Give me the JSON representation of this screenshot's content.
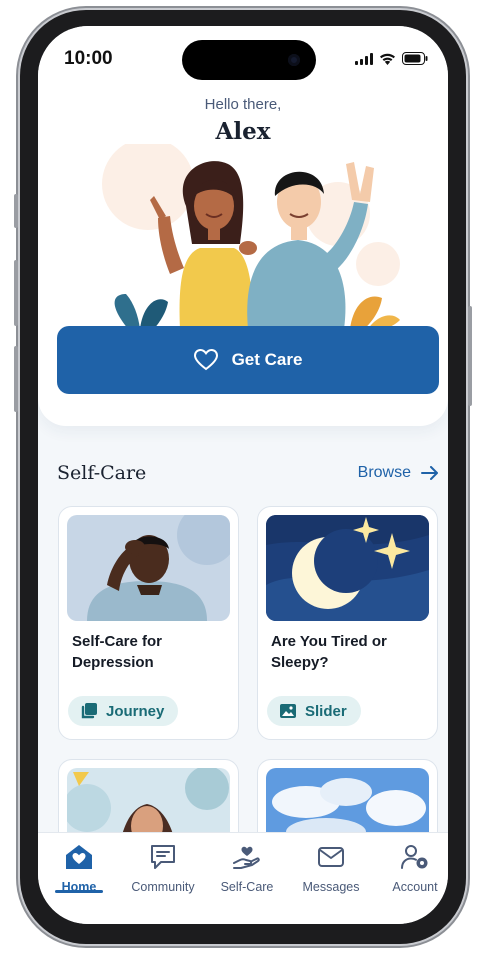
{
  "status_bar": {
    "time": "10:00"
  },
  "greeting": {
    "salutation": "Hello there,",
    "name": "Alex"
  },
  "get_care_button": {
    "label": "Get Care",
    "icon": "heart-outline-icon"
  },
  "self_care": {
    "title": "Self-Care",
    "browse_label": "Browse",
    "cards": [
      {
        "title": "Self-Care for Depression",
        "chip_label": "Journey",
        "chip_icon": "journey-stack-icon",
        "image": "man-holding-head-photo"
      },
      {
        "title": "Are You Tired or Sleepy?",
        "chip_label": "Slider",
        "chip_icon": "image-icon",
        "image": "moon-and-stars-illustration"
      },
      {
        "image": "girl-hugging-knees-illustration"
      },
      {
        "image": "blue-sky-clouds-photo"
      }
    ]
  },
  "bottom_nav": [
    {
      "label": "Home",
      "icon": "home-heart-icon",
      "active": true
    },
    {
      "label": "Community",
      "icon": "chat-bubble-icon",
      "active": false
    },
    {
      "label": "Self-Care",
      "icon": "hand-heart-icon",
      "active": false
    },
    {
      "label": "Messages",
      "icon": "envelope-icon",
      "active": false
    },
    {
      "label": "Account",
      "icon": "user-gear-icon",
      "active": false
    }
  ],
  "colors": {
    "primary": "#1f62a8",
    "chip_bg": "#e3f1f2",
    "chip_text": "#1a6b76",
    "background": "#f4f7fa"
  }
}
